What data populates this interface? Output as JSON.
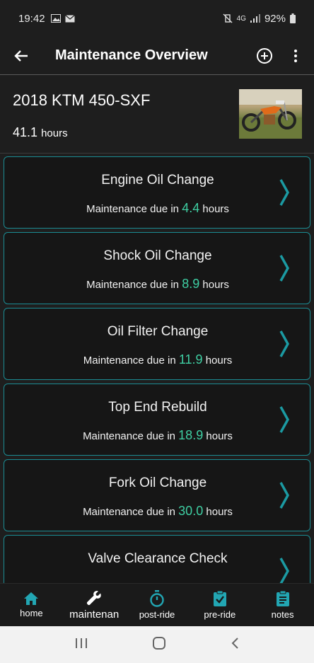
{
  "status": {
    "time": "19:42",
    "battery": "92%",
    "network": "4G"
  },
  "appbar": {
    "title": "Maintenance Overview"
  },
  "bike": {
    "name": "2018 KTM 450-SXF",
    "hours_value": "41.1",
    "hours_unit": "hours"
  },
  "tasks": [
    {
      "title": "Engine Oil Change",
      "prefix": "Maintenance due in",
      "value": "4.4",
      "unit": "hours"
    },
    {
      "title": "Shock Oil Change",
      "prefix": "Maintenance due in",
      "value": "8.9",
      "unit": "hours"
    },
    {
      "title": "Oil Filter Change",
      "prefix": "Maintenance due in",
      "value": "11.9",
      "unit": "hours"
    },
    {
      "title": "Top End Rebuild",
      "prefix": "Maintenance due in",
      "value": "18.9",
      "unit": "hours"
    },
    {
      "title": "Fork Oil Change",
      "prefix": "Maintenance due in",
      "value": "30.0",
      "unit": "hours"
    },
    {
      "title": "Valve Clearance Check",
      "prefix": "",
      "value": "",
      "unit": ""
    }
  ],
  "nav": [
    {
      "label": "home",
      "icon": "home-icon"
    },
    {
      "label": "maintenan",
      "icon": "wrench-icon"
    },
    {
      "label": "post-ride",
      "icon": "stopwatch-icon"
    },
    {
      "label": "pre-ride",
      "icon": "clipboard-check-icon"
    },
    {
      "label": "notes",
      "icon": "clipboard-list-icon"
    }
  ],
  "colors": {
    "accent": "#1b8c93",
    "value": "#3fcfa3",
    "background": "#1e1e1e"
  }
}
